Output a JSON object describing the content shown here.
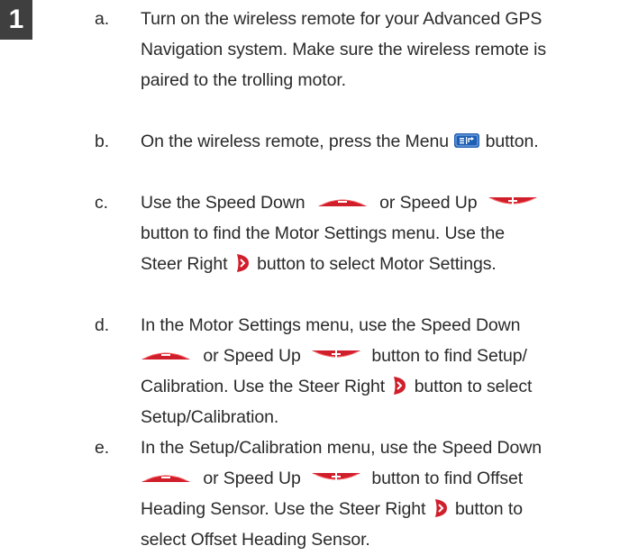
{
  "step_number": "1",
  "steps": {
    "a": {
      "letter": "a.",
      "line1": "Turn on the wireless remote for your Advanced GPS",
      "line2": "Navigation system. Make sure the wireless remote is",
      "line3": "paired to the trolling motor."
    },
    "b": {
      "letter": "b.",
      "before_icon": "On the wireless remote, press the Menu",
      "after_icon": "button."
    },
    "c": {
      "letter": "c.",
      "t1": "Use the Speed Down",
      "t2": "or Speed Up",
      "line2": "button to find the Motor Settings menu. Use the",
      "t3": "Steer Right",
      "t4": "button to select Motor Settings."
    },
    "d": {
      "letter": "d.",
      "line1": "In the Motor Settings menu, use the Speed Down",
      "t1": "or Speed Up",
      "t2": "button to find Setup/",
      "t3": "Calibration. Use the Steer Right",
      "t4": "button to select",
      "line4": "Setup/Calibration."
    },
    "e": {
      "letter": "e.",
      "line1": "In the Setup/Calibration menu, use the Speed Down",
      "t1": "or Speed Up",
      "t2": "button to find Offset",
      "t3": "Heading Sensor. Use the Steer Right",
      "t4": "button to",
      "line4": "select Offset Heading Sensor."
    }
  },
  "icons": {
    "menu": "menu-button-icon",
    "speed_down": "speed-down-button-icon",
    "speed_up": "speed-up-button-icon",
    "steer_right": "steer-right-button-icon"
  },
  "colors": {
    "badge_bg": "#3f3f3f",
    "menu_blue": "#1e5fb4",
    "button_red": "#d01e2b",
    "text": "#2a2a2a"
  }
}
